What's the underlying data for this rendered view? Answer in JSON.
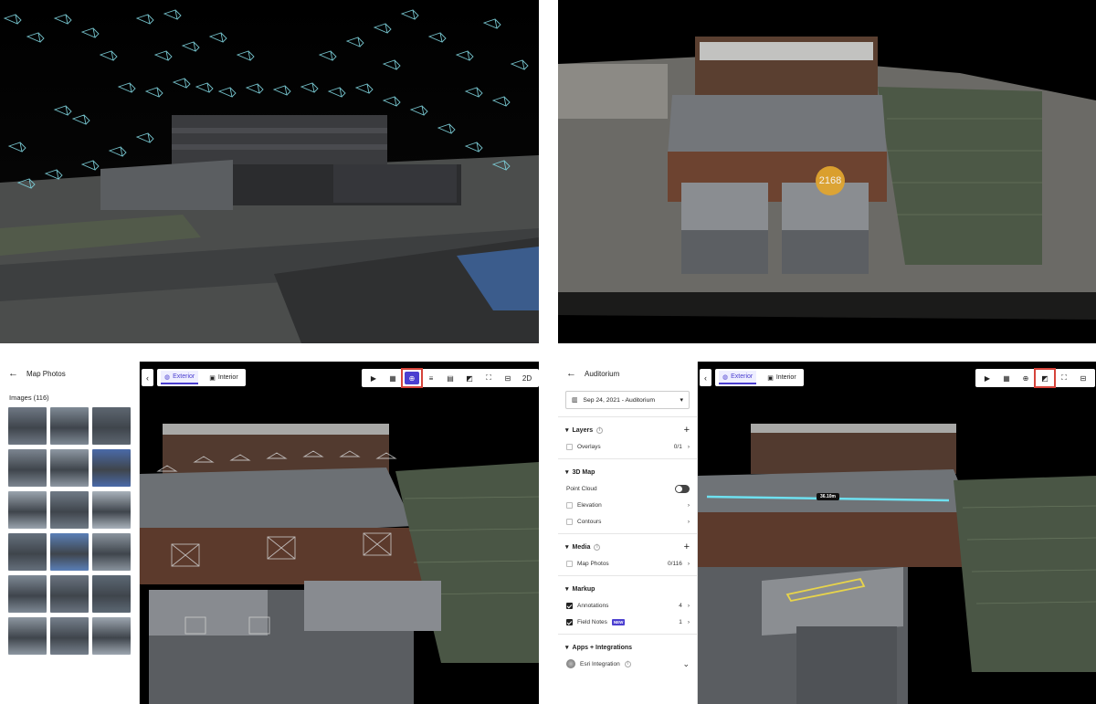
{
  "q2": {
    "point_count": "2168"
  },
  "map_photos": {
    "title": "Map Photos",
    "images_label": "Images (116)",
    "thumb_colors": [
      "#6f7884",
      "#7f8a95",
      "#5d6670",
      "#7c8590",
      "#8e98a3",
      "#4a6aa8",
      "#9aa4ae",
      "#707a86",
      "#a9b2bb",
      "#65707c",
      "#5a7fb7",
      "#8a949e",
      "#7e8995",
      "#6a7480",
      "#5c6874",
      "#8d97a1",
      "#76808c",
      "#9da6b0"
    ]
  },
  "viewer": {
    "exterior_label": "Exterior",
    "interior_label": "Interior",
    "tool_2d_label": "2D"
  },
  "auditorium": {
    "title": "Auditorium",
    "date_select": "Sep 24, 2021 - Auditorium",
    "layers": {
      "title": "Layers",
      "overlays": "Overlays",
      "overlays_count": "0/1"
    },
    "map3d": {
      "title": "3D Map",
      "point_cloud": "Point Cloud",
      "elevation": "Elevation",
      "contours": "Contours"
    },
    "media": {
      "title": "Media",
      "map_photos": "Map Photos",
      "map_photos_count": "0/116"
    },
    "markup": {
      "title": "Markup",
      "annotations": "Annotations",
      "annotations_count": "4",
      "field_notes": "Field Notes",
      "new_badge": "NEW",
      "field_notes_count": "1"
    },
    "apps": {
      "title": "Apps + Integrations",
      "esri": "Esri Integration"
    },
    "measurement": "36.10m"
  },
  "colors": {
    "accent": "#4b3fd0",
    "highlight": "#d6443b",
    "badge": "#e4a72e"
  }
}
